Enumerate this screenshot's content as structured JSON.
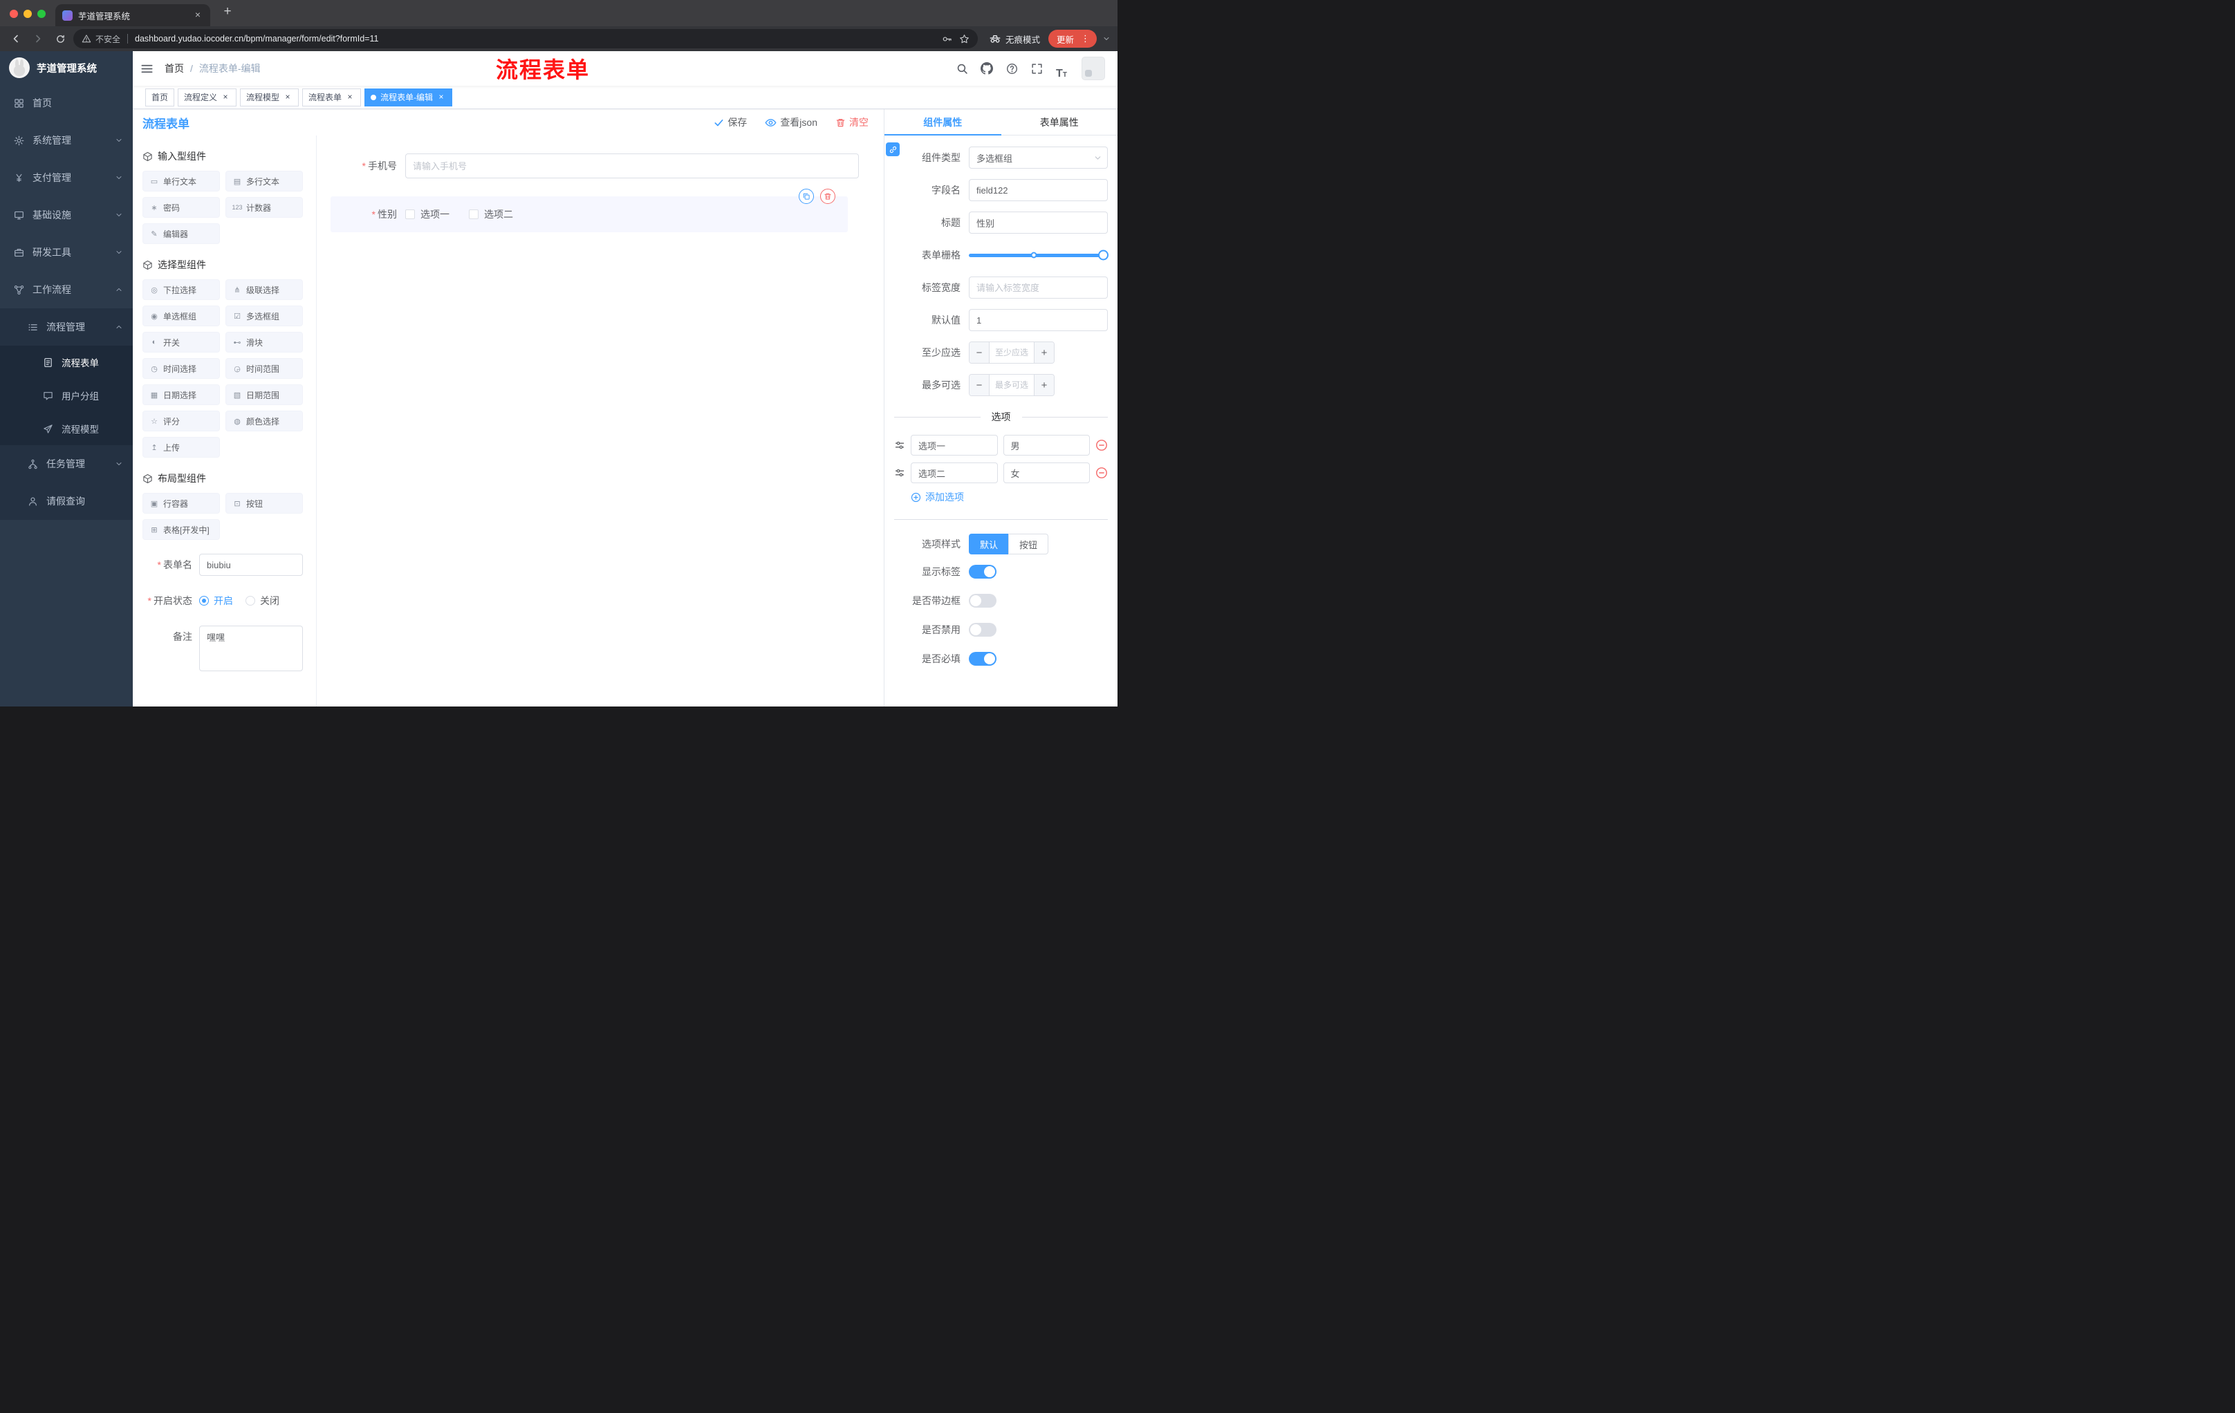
{
  "colors": {
    "accent": "#409EFF",
    "danger": "#F56C6C",
    "watermark": "#FF1414",
    "sidebar_bg": "#2C3A4B",
    "tag_active_bg": "#409EFF",
    "update_button_bg": "#E25044"
  },
  "icons": {
    "required_mark": "*",
    "close": "×",
    "new_tab": "+",
    "kebab": "⋮",
    "minus": "−",
    "plus": "+",
    "fontsize_large": "T",
    "fontsize_small": "T"
  },
  "browser": {
    "tab_title": "芋道管理系统",
    "security_label": "不安全",
    "url": "dashboard.yudao.iocoder.cn/bpm/manager/form/edit?formId=11",
    "incognito_label": "无痕模式",
    "update_label": "更新"
  },
  "sidebar": {
    "logo_title": "芋道管理系统",
    "menu": [
      {
        "label": "首页"
      },
      {
        "label": "系统管理"
      },
      {
        "label": "支付管理"
      },
      {
        "label": "基础设施"
      },
      {
        "label": "研发工具"
      },
      {
        "label": "工作流程"
      }
    ],
    "submenu": {
      "label": "流程管理",
      "children": [
        {
          "label": "流程表单"
        },
        {
          "label": "用户分组"
        },
        {
          "label": "流程模型"
        }
      ]
    },
    "more": [
      {
        "label": "任务管理"
      },
      {
        "label": "请假查询"
      }
    ]
  },
  "header": {
    "breadcrumb_home": "首页",
    "breadcrumb_sep": "/",
    "breadcrumb_current": "流程表单-编辑",
    "watermark": "流程表单"
  },
  "tags": [
    {
      "label": "首页",
      "closable": false,
      "active": false
    },
    {
      "label": "流程定义",
      "closable": true,
      "active": false
    },
    {
      "label": "流程模型",
      "closable": true,
      "active": false
    },
    {
      "label": "流程表单",
      "closable": true,
      "active": false
    },
    {
      "label": "流程表单-编辑",
      "closable": true,
      "active": true
    }
  ],
  "designer": {
    "title": "流程表单",
    "save_label": "保存",
    "view_json_label": "查看json",
    "clear_label": "清空"
  },
  "palette": {
    "groups": [
      {
        "title": "输入型组件",
        "items": [
          {
            "icon": "▭",
            "label": "单行文本"
          },
          {
            "icon": "▤",
            "label": "多行文本"
          },
          {
            "icon": "∗",
            "label": "密码"
          },
          {
            "icon": "123",
            "label": "计数器"
          },
          {
            "icon": "✎",
            "label": "编辑器"
          }
        ]
      },
      {
        "title": "选择型组件",
        "items": [
          {
            "icon": "◎",
            "label": "下拉选择"
          },
          {
            "icon": "⋔",
            "label": "级联选择"
          },
          {
            "icon": "◉",
            "label": "单选框组"
          },
          {
            "icon": "☑",
            "label": "多选框组"
          },
          {
            "icon": "◐",
            "label": "开关"
          },
          {
            "icon": "⊷",
            "label": "滑块"
          },
          {
            "icon": "◷",
            "label": "时间选择"
          },
          {
            "icon": "◶",
            "label": "时间范围"
          },
          {
            "icon": "▦",
            "label": "日期选择"
          },
          {
            "icon": "▧",
            "label": "日期范围"
          },
          {
            "icon": "☆",
            "label": "评分"
          },
          {
            "icon": "◍",
            "label": "颜色选择"
          },
          {
            "icon": "↥",
            "label": "上传"
          }
        ]
      },
      {
        "title": "布局型组件",
        "items": [
          {
            "icon": "▣",
            "label": "行容器"
          },
          {
            "icon": "⊡",
            "label": "按钮"
          },
          {
            "icon": "⊞",
            "label": "表格[开发中]"
          }
        ]
      }
    ]
  },
  "form_meta": {
    "name_label": "表单名",
    "name_value": "biubiu",
    "status_label": "开启状态",
    "status_on": "开启",
    "status_off": "关闭",
    "remark_label": "备注",
    "remark_value": "嘿嘿"
  },
  "canvas": {
    "phone": {
      "label": "手机号",
      "placeholder": "请输入手机号"
    },
    "gender": {
      "label": "性别",
      "options": [
        "选项一",
        "选项二"
      ]
    }
  },
  "props": {
    "tab_component": "组件属性",
    "tab_form": "表单属性",
    "rows": {
      "type_label": "组件类型",
      "type_value": "多选框组",
      "field_label": "字段名",
      "field_value": "field122",
      "title_label": "标题",
      "title_value": "性别",
      "grid_label": "表单栅格",
      "label_width_label": "标签宽度",
      "label_width_placeholder": "请输入标签宽度",
      "default_label": "默认值",
      "default_value": "1",
      "min_label": "至少应选",
      "min_placeholder": "至少应选",
      "max_label": "最多可选",
      "max_placeholder": "最多可选"
    },
    "options_divider": "选项",
    "options": [
      {
        "label": "选项一",
        "value": "男"
      },
      {
        "label": "选项二",
        "value": "女"
      }
    ],
    "add_option": "添加选项",
    "style_label": "选项样式",
    "style_default": "默认",
    "style_button": "按钮",
    "toggles": [
      {
        "label": "显示标签",
        "on": true
      },
      {
        "label": "是否带边框",
        "on": false
      },
      {
        "label": "是否禁用",
        "on": false
      },
      {
        "label": "是否必填",
        "on": true
      }
    ]
  }
}
